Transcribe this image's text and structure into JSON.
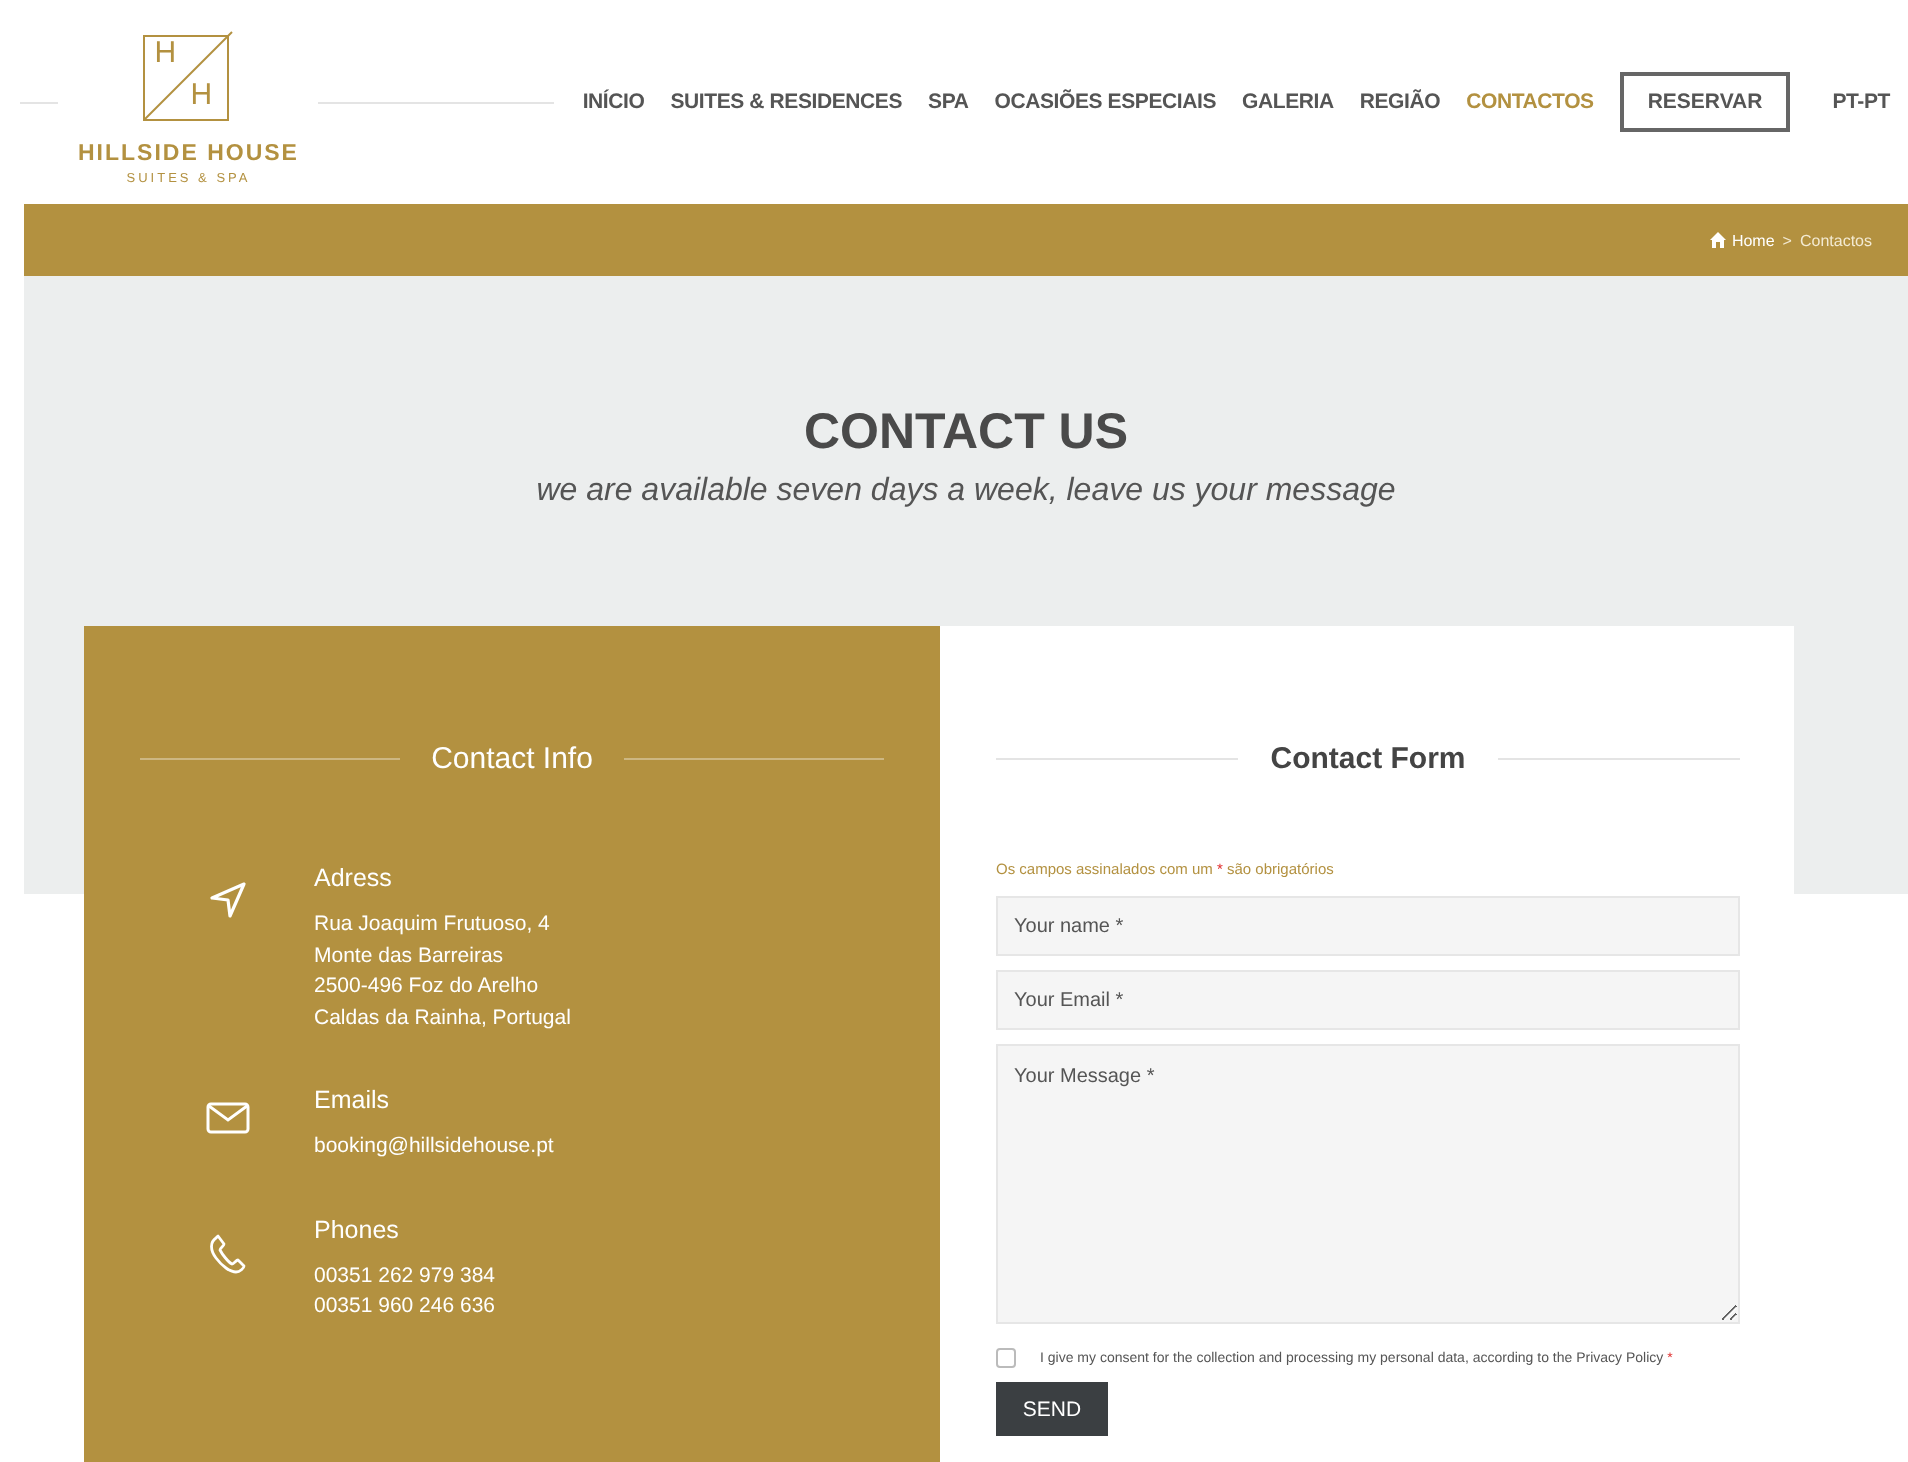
{
  "logo": {
    "letters": [
      "H",
      "H"
    ],
    "name": "HILLSIDE HOUSE",
    "tagline": "SUITES & SPA"
  },
  "nav": [
    {
      "label": "INÍCIO",
      "kind": "link",
      "selected": false
    },
    {
      "label": "SUITES & RESIDENCES",
      "kind": "link",
      "selected": false
    },
    {
      "label": "SPA",
      "kind": "link",
      "selected": false
    },
    {
      "label": "OCASIÕES ESPECIAIS",
      "kind": "link",
      "selected": false
    },
    {
      "label": "GALERIA",
      "kind": "link",
      "selected": false
    },
    {
      "label": "REGIÃO",
      "kind": "link",
      "selected": false
    },
    {
      "label": "CONTACTOS",
      "kind": "link",
      "selected": true
    },
    {
      "label": "RESERVAR",
      "kind": "button",
      "selected": false
    },
    {
      "label": "PT-PT",
      "kind": "link",
      "selected": false
    }
  ],
  "breadcrumb": {
    "home": "Home",
    "separator": ">",
    "current": "Contactos"
  },
  "hero": {
    "title": "CONTACT US",
    "subtitle": "we are available seven days a week, leave us your message"
  },
  "contact_info": {
    "title": "Contact Info",
    "items": [
      {
        "kind": "address",
        "title": "Adress",
        "lines": [
          "Rua Joaquim Frutuoso, 4",
          "Monte das Barreiras",
          "2500-496 Foz do Arelho",
          "Caldas da Rainha, Portugal"
        ]
      },
      {
        "kind": "email",
        "title": "Emails",
        "lines": [
          "booking@hillsidehouse.pt"
        ]
      },
      {
        "kind": "phone",
        "title": "Phones",
        "lines": [
          "00351 262 979 384",
          "00351 960 246 636"
        ]
      }
    ]
  },
  "contact_form": {
    "title": "Contact Form",
    "note": "Os campos assinalados com um",
    "note_mark": "*",
    "note_end": "são obrigatórios",
    "fields": [
      {
        "kind": "input",
        "placeholder": "Your name *"
      },
      {
        "kind": "input",
        "placeholder": "Your Email *"
      },
      {
        "kind": "textarea",
        "placeholder": "Your Message *"
      }
    ],
    "consent": {
      "label": "I give my consent for the collection and processing my personal data, according to the Privacy Policy",
      "mark": "*",
      "checked": false
    },
    "submit": "SEND"
  }
}
